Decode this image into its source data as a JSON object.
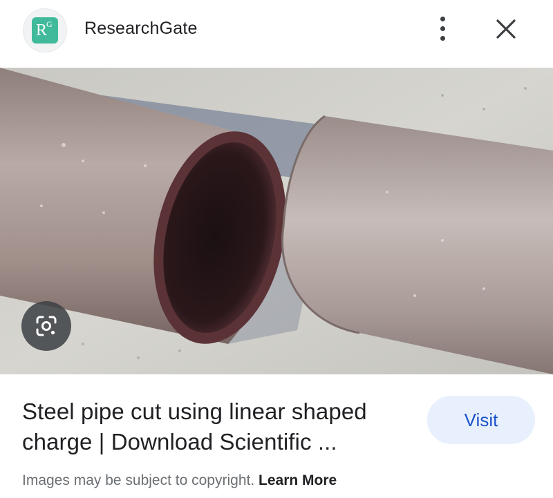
{
  "header": {
    "logo_letters": {
      "main": "R",
      "super": "G"
    },
    "site_name": "ResearchGate",
    "more_icon": "more-vert-icon",
    "close_icon": "close-icon"
  },
  "image": {
    "lens_icon": "google-lens-icon"
  },
  "result": {
    "title_line1": "Steel pipe cut using linear shaped",
    "title_line2": "charge | Download Scientific ...",
    "visit_label": "Visit"
  },
  "footer": {
    "notice": "Images may be subject to copyright.",
    "learn_more": "Learn More"
  },
  "colors": {
    "brand_teal": "#40ba9b",
    "visit_bg": "#e8f0fe",
    "visit_text": "#1a53c7"
  }
}
